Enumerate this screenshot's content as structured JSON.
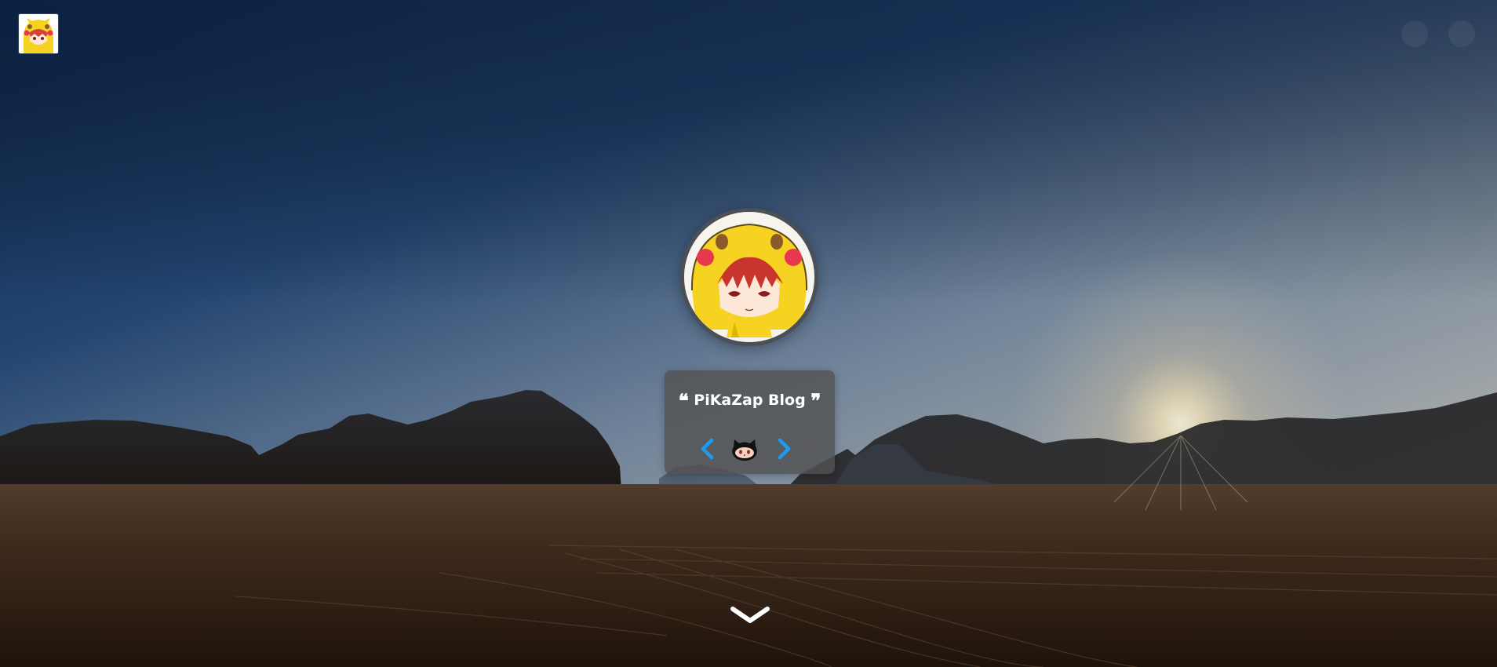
{
  "header": {
    "logo_icon": "pikachu-hood-avatar-icon",
    "right_icons": [
      "faint-circle-icon",
      "faint-circle-icon"
    ]
  },
  "profile": {
    "avatar_icon": "pikachu-hood-avatar-icon"
  },
  "info_card": {
    "open_quote": "❝",
    "blog_title": "PiKaZap Blog",
    "close_quote": "❞",
    "prev_icon": "chevron-left-icon",
    "social_icon": "github-icon",
    "next_icon": "chevron-right-icon"
  },
  "scroll_icon": "chevron-down-icon",
  "colors": {
    "accent_blue": "#1e9bf0",
    "card_bg": "#525252",
    "avatar_border": "#4b4f58",
    "pikachu_yellow": "#f6d321",
    "cheek_red": "#e8384f"
  }
}
